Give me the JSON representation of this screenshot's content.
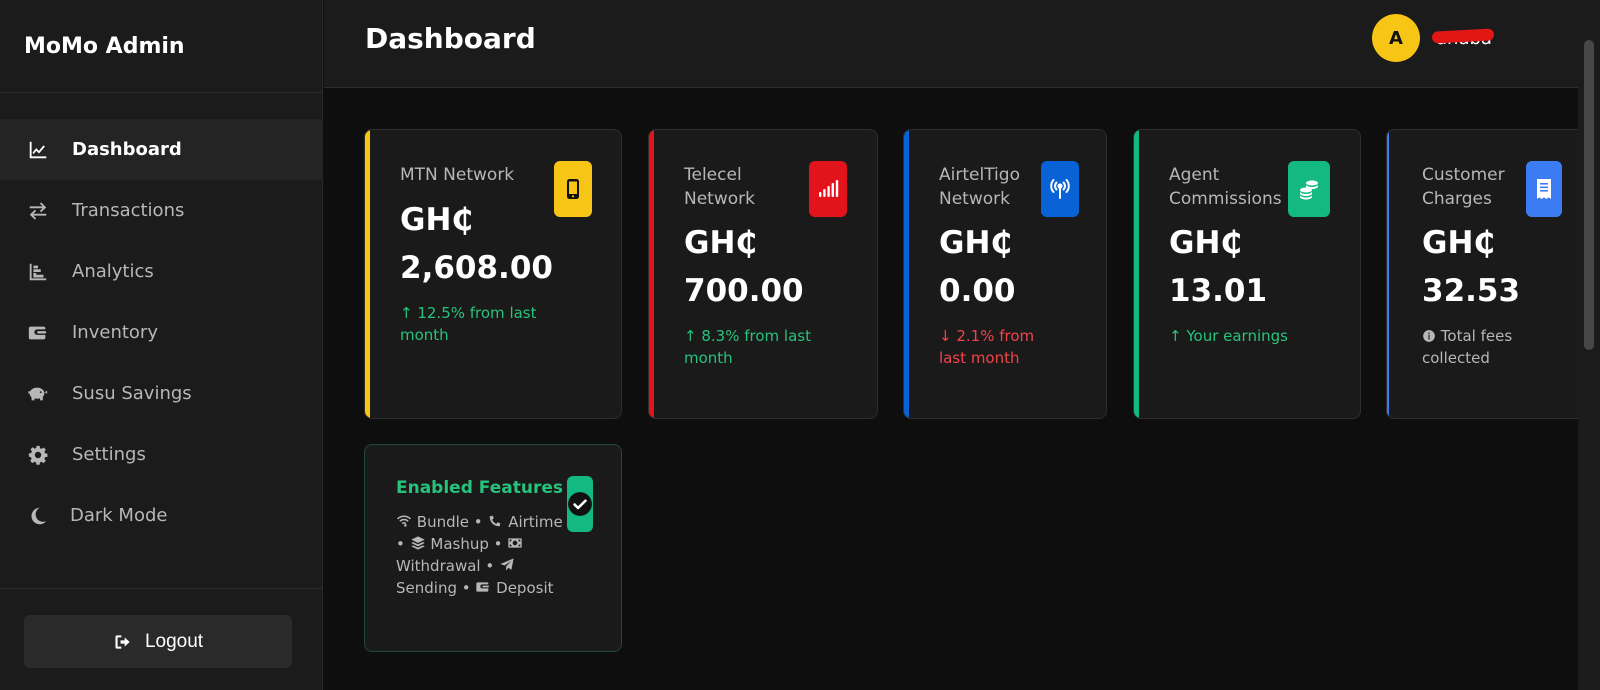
{
  "sidebar": {
    "brand": "MoMo Admin",
    "items": [
      {
        "label": "Dashboard",
        "icon": "chart-line-icon",
        "active": true
      },
      {
        "label": "Transactions",
        "icon": "arrows-exchange-icon"
      },
      {
        "label": "Analytics",
        "icon": "bar-chart-icon"
      },
      {
        "label": "Inventory",
        "icon": "wallet-icon"
      },
      {
        "label": "Susu Savings",
        "icon": "piggy-bank-icon"
      },
      {
        "label": "Settings",
        "icon": "gear-icon"
      },
      {
        "label": "Dark Mode",
        "icon": "moon-icon"
      }
    ],
    "logout": "Logout"
  },
  "header": {
    "title": "Dashboard",
    "avatar_initial": "A",
    "username": "anaba"
  },
  "cards": [
    {
      "label": "MTN Network",
      "currency": "GH₵",
      "amount": "2,608.00",
      "note": "12.5% from last month",
      "trend": "up",
      "icon": "mobile-phone-icon",
      "accent": "#f7c515"
    },
    {
      "label": "Telecel Network",
      "currency": "GH₵",
      "amount": "700.00",
      "note": "8.3% from last month",
      "trend": "up",
      "icon": "signal-bars-icon",
      "accent": "#e3131b"
    },
    {
      "label": "AirtelTigo Network",
      "currency": "GH₵",
      "amount": "0.00",
      "note": "2.1% from last month",
      "trend": "down",
      "icon": "broadcast-tower-icon",
      "accent": "#0a63d6"
    },
    {
      "label": "Agent Commissions",
      "currency": "GH₵",
      "amount": "13.01",
      "note": "Your earnings",
      "trend": "up",
      "icon": "coins-icon",
      "accent": "#13b981"
    },
    {
      "label": "Customer Charges",
      "currency": "GH₵",
      "amount": "32.53",
      "note": "Total fees collected",
      "trend": "info",
      "icon": "receipt-icon",
      "accent": "#3b7cf2"
    }
  ],
  "features": {
    "title": "Enabled Features",
    "icon": "check-circle-icon",
    "accent": "#13b981",
    "items": [
      {
        "label": "Bundle",
        "icon": "wifi-icon"
      },
      {
        "label": "Airtime",
        "icon": "phone-icon"
      },
      {
        "label": "Mashup",
        "icon": "layers-icon"
      },
      {
        "label": "Withdrawal",
        "icon": "money-bill-icon"
      },
      {
        "label": "Sending",
        "icon": "paper-plane-icon"
      },
      {
        "label": "Deposit",
        "icon": "wallet-icon"
      }
    ]
  }
}
